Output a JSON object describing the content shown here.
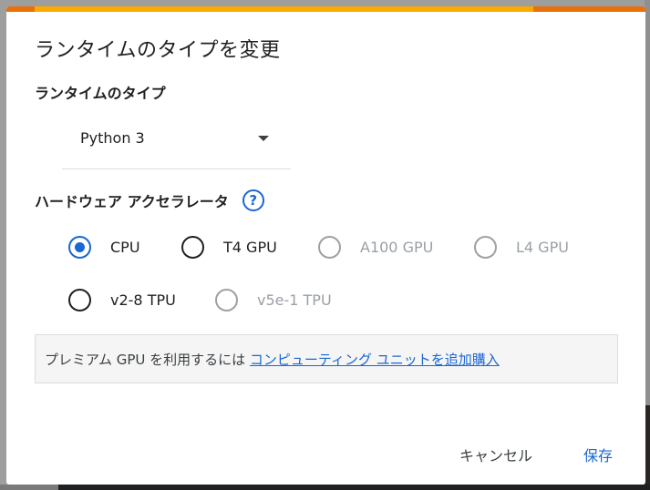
{
  "dialog": {
    "title": "ランタイムのタイプを変更",
    "runtime_type": {
      "label": "ランタイムのタイプ",
      "selected": "Python 3"
    },
    "hardware_accelerator": {
      "label": "ハードウェア アクセラレータ",
      "help_icon": "?",
      "options": [
        {
          "label": "CPU",
          "checked": true,
          "disabled": false
        },
        {
          "label": "T4 GPU",
          "checked": false,
          "disabled": false
        },
        {
          "label": "A100 GPU",
          "checked": false,
          "disabled": true
        },
        {
          "label": "L4 GPU",
          "checked": false,
          "disabled": true
        },
        {
          "label": "v2-8 TPU",
          "checked": false,
          "disabled": false
        },
        {
          "label": "v5e-1 TPU",
          "checked": false,
          "disabled": true
        }
      ]
    },
    "info": {
      "text": "プレミアム GPU を利用するには ",
      "link": "コンピューティング ユニットを追加購入"
    },
    "buttons": {
      "cancel": "キャンセル",
      "save": "保存"
    }
  },
  "colors": {
    "accent": "#1967d2",
    "top_bar_orange": "#e8710a",
    "top_bar_yellow": "#f9ab00"
  }
}
